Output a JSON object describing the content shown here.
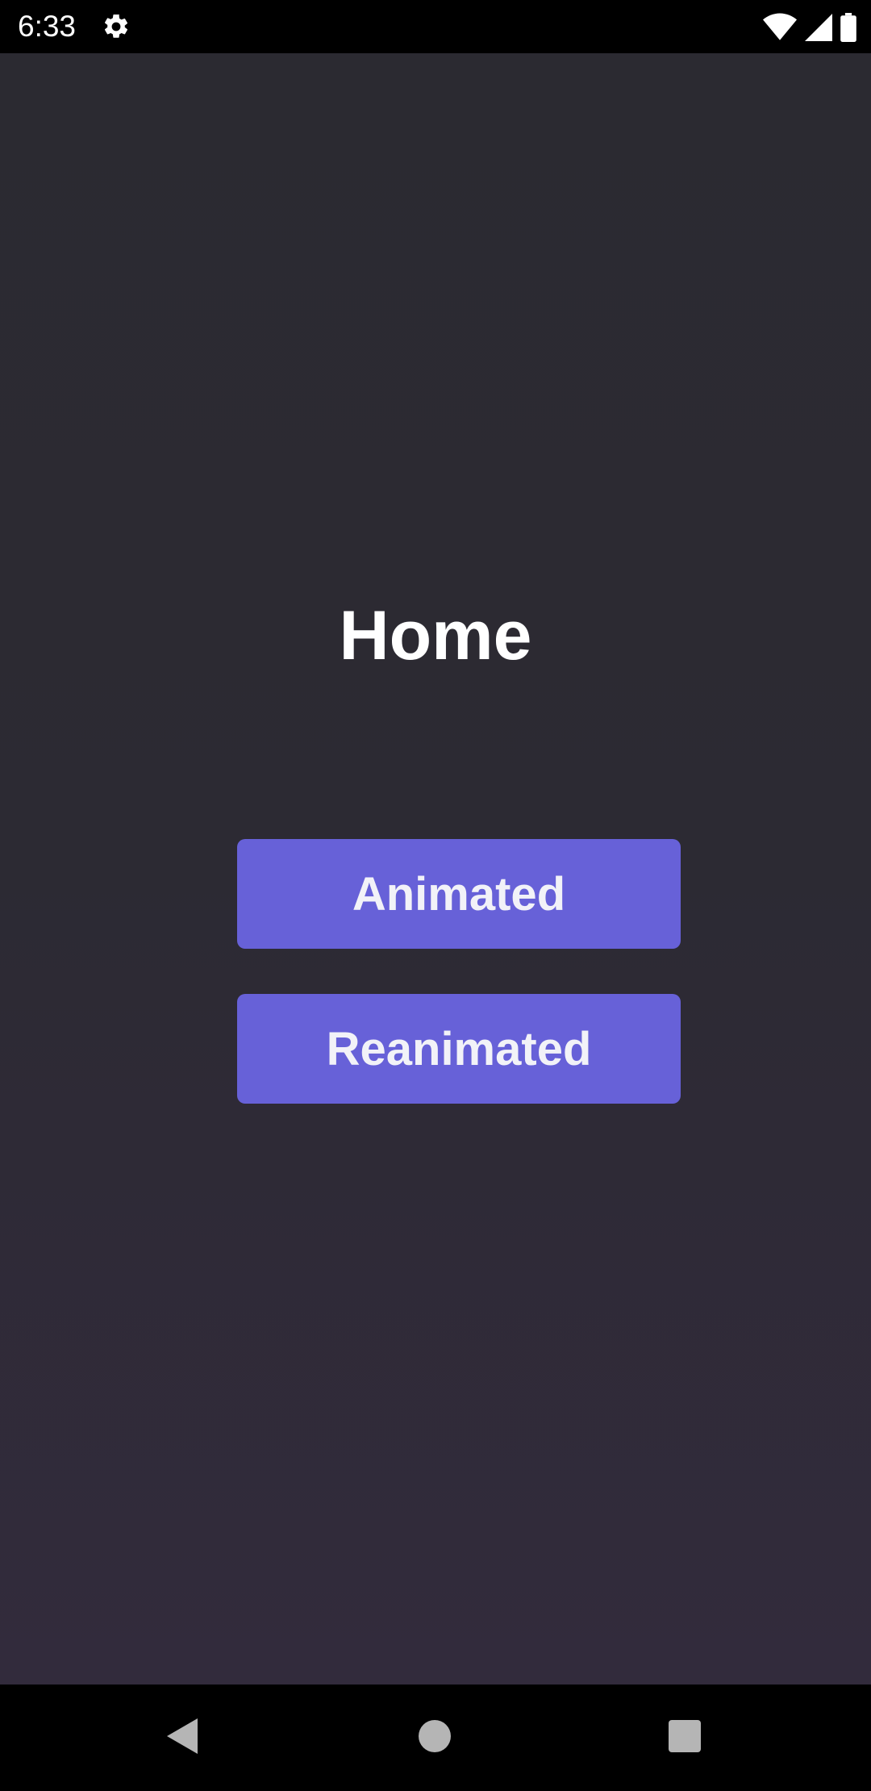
{
  "status_bar": {
    "time": "6:33",
    "icons": [
      "settings-gear-icon",
      "wifi-icon",
      "cellular-signal-icon",
      "battery-icon"
    ]
  },
  "home": {
    "title": "Home",
    "buttons": [
      {
        "label": "Animated"
      },
      {
        "label": "Reanimated"
      }
    ]
  },
  "nav_bar": {
    "icons": [
      "back-icon",
      "home-icon",
      "recents-icon"
    ]
  },
  "colors": {
    "background": "#2c2a33",
    "button": "#6761d8",
    "button_text": "#f2f2f8",
    "title_text": "#ffffff",
    "system_bars": "#000000"
  }
}
